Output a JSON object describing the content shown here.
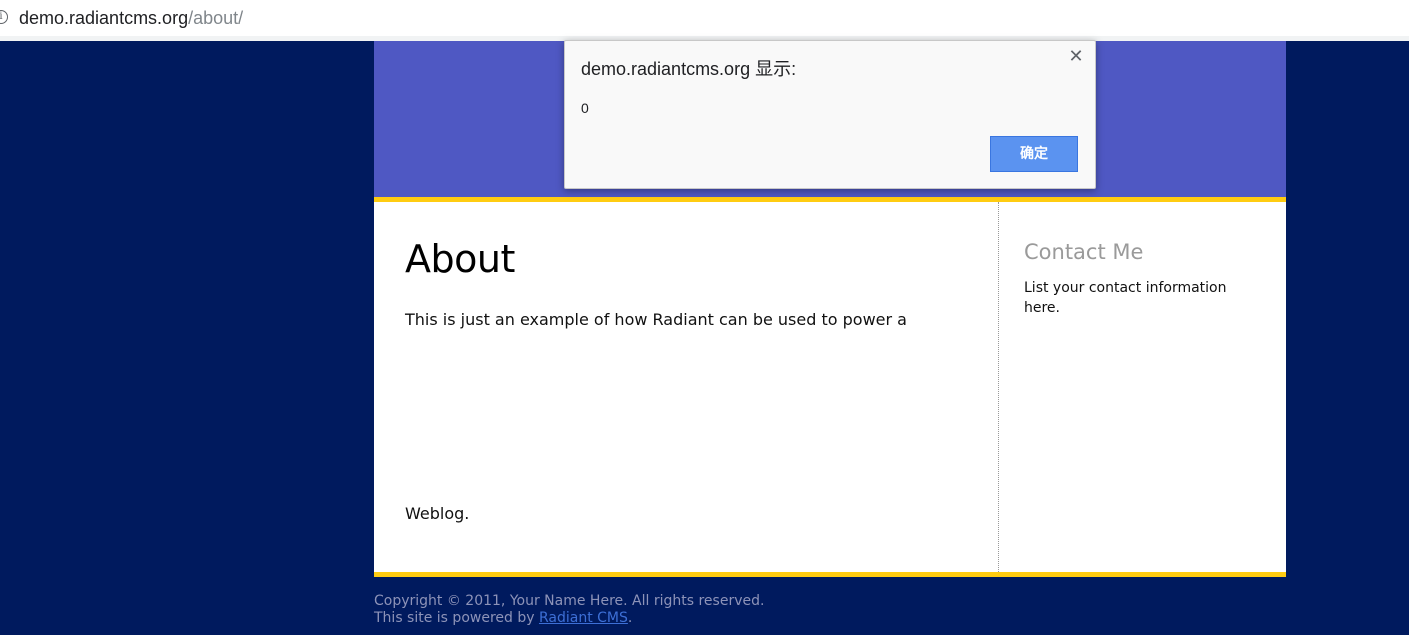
{
  "browser": {
    "url_host": "demo.radiantcms.org",
    "url_path": "/about/",
    "info_icon": "info-icon"
  },
  "page": {
    "title": "About",
    "paragraph_1": "This is just an example of how Radiant can be used to power a",
    "paragraph_2": "Weblog.",
    "sidebar": {
      "heading": "Contact Me",
      "text": "List your contact information here."
    },
    "footer": {
      "copyright": "Copyright © 2011, Your Name Here. All rights reserved.",
      "powered_prefix": "This site is powered by ",
      "powered_link": "Radiant CMS",
      "powered_suffix": "."
    },
    "colors": {
      "background": "#001a5e",
      "header": "#4f58c3",
      "accent_rule": "#ffcc11"
    }
  },
  "dialog": {
    "title": "demo.radiantcms.org 显示:",
    "message": "0",
    "ok_label": "确定",
    "close_symbol": "✕"
  }
}
